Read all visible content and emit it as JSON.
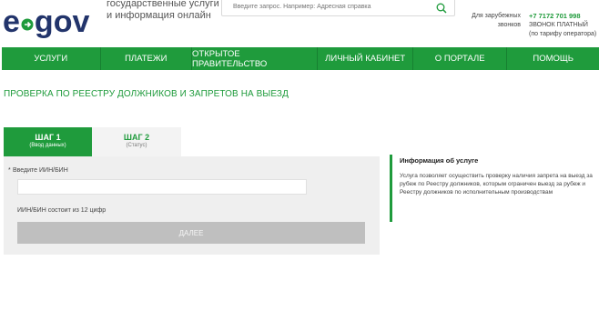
{
  "header": {
    "logo": {
      "left": "e",
      "right": "gov"
    },
    "tagline": [
      "государственные услуги",
      "и информация онлайн"
    ],
    "search": {
      "placeholder": "Введите запрос. Например: Адресная справка"
    },
    "abroad": [
      "Для зарубежных",
      "звонков"
    ],
    "phone": {
      "number": "+7 7172 701 998",
      "line1": "ЗВОНОК ПЛАТНЫЙ",
      "line2": "(по тарифу оператора)"
    }
  },
  "nav": {
    "items": [
      {
        "label": "УСЛУГИ"
      },
      {
        "label": "ПЛАТЕЖИ"
      },
      {
        "label": "ОТКРЫТОЕ ПРАВИТЕЛЬСТВО"
      },
      {
        "label": "ЛИЧНЫЙ КАБИНЕТ"
      },
      {
        "label": "О ПОРТАЛЕ"
      },
      {
        "label": "ПОМОЩЬ"
      }
    ]
  },
  "page": {
    "title": "ПРОВЕРКА ПО РЕЕСТРУ ДОЛЖНИКОВ И ЗАПРЕТОВ НА ВЫЕЗД"
  },
  "steps": [
    {
      "title": "ШАГ 1",
      "subtitle": "(Ввод данных)"
    },
    {
      "title": "ШАГ 2",
      "subtitle": "(Статус)"
    }
  ],
  "form": {
    "required_mark": "*",
    "label": "Введите ИИН/БИН",
    "value": "",
    "hint": "ИИН/БИН состоит из 12 цифр",
    "submit_label": "ДАЛЕЕ"
  },
  "info": {
    "title": "Информация об услуге",
    "text": "Услуга позволяет осуществить проверку наличия запрета на выезд за рубеж по Реестру должников, которым ограничен выезд за рубеж и Реестру должников по исполнительным производствам"
  },
  "colors": {
    "brand_green": "#1f9b3c",
    "logo_navy": "#22346b",
    "disabled_button": "#bfbfbf",
    "panel_bg": "#efefef"
  }
}
